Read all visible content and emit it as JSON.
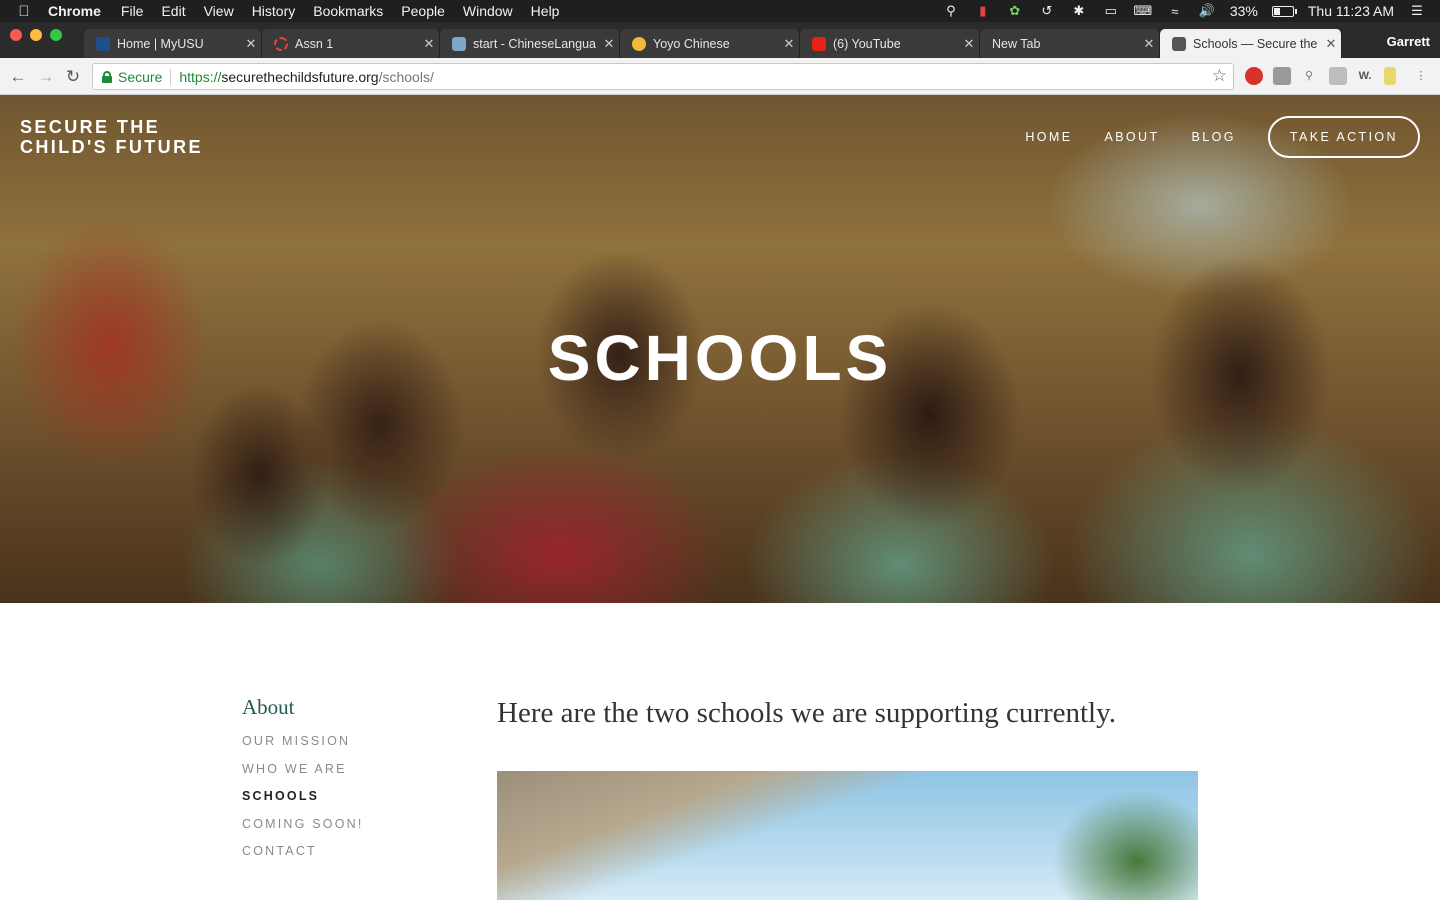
{
  "menubar": {
    "apple": "",
    "app_name": "Chrome",
    "items": [
      "File",
      "Edit",
      "View",
      "History",
      "Bookmarks",
      "People",
      "Window",
      "Help"
    ],
    "battery": "33%",
    "clock": "Thu 11:23 AM",
    "battery_level": 0.33
  },
  "tabs": [
    {
      "title": "Home | MyUSU",
      "favicon_color": "#1f4e8c"
    },
    {
      "title": "Assn 1",
      "favicon_color": "#e0463c"
    },
    {
      "title": "start - ChineseLangua",
      "favicon_color": "#7fa6c9"
    },
    {
      "title": "Yoyo Chinese",
      "favicon_color": "#f2b93b"
    },
    {
      "title": "(6) YouTube",
      "favicon_color": "#e62117"
    },
    {
      "title": "New Tab",
      "favicon_color": ""
    },
    {
      "title": "Schools — Secure the",
      "favicon_color": "#555555"
    }
  ],
  "profile_name": "Garrett",
  "toolbar": {
    "secure_label": "Secure",
    "url_proto": "https://",
    "url_host": "securethechildsfuture.org",
    "url_path": "/schools/",
    "star": "☆"
  },
  "site": {
    "title_line1": "SECURE THE",
    "title_line2": "CHILD'S FUTURE",
    "nav": [
      "HOME",
      "ABOUT",
      "BLOG"
    ],
    "cta": "TAKE ACTION",
    "hero_title": "SCHOOLS"
  },
  "sidebar": {
    "heading": "About",
    "links": [
      "OUR MISSION",
      "WHO WE ARE",
      "SCHOOLS",
      "COMING SOON!",
      "CONTACT"
    ]
  },
  "content": {
    "lead": "Here are the two schools we are supporting currently."
  },
  "colors": {
    "accent_green": "#1f5c52",
    "secure_green": "#1d8a35"
  }
}
